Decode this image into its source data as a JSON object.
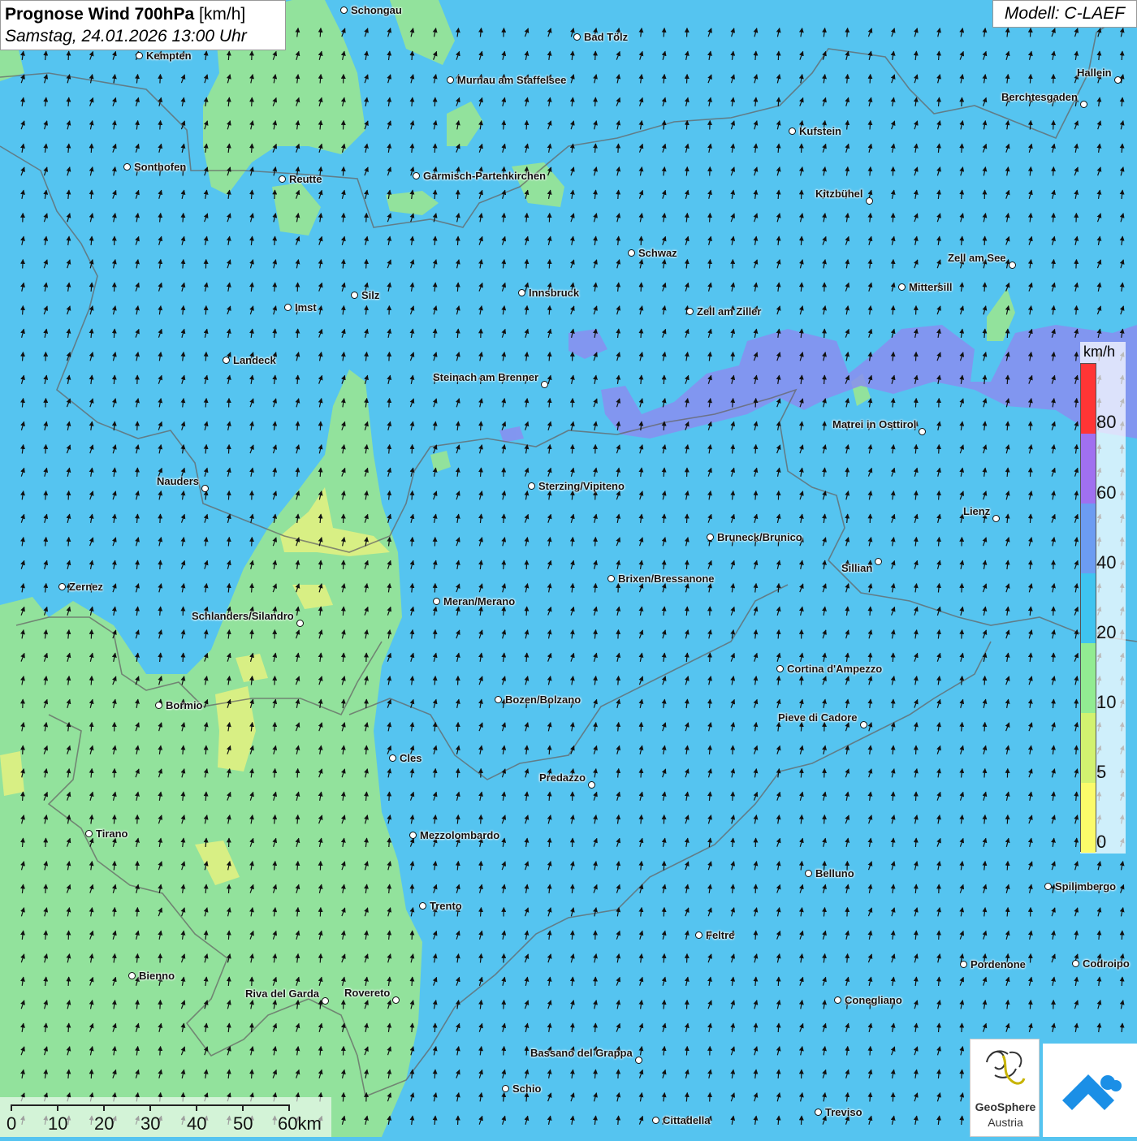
{
  "title": {
    "main": "Prognose Wind 700hPa",
    "unit": "[km/h]",
    "datetime": "Samstag, 24.01.2026 13:00 Uhr"
  },
  "model": "Modell: C-LAEF",
  "legend": {
    "unit": "km/h",
    "ticks": [
      "80",
      "60",
      "40",
      "20",
      "10",
      "5",
      "0"
    ],
    "colors": [
      "#ff3535",
      "#a070f0",
      "#6c9cf2",
      "#3fc4f0",
      "#92ec92",
      "#d2f270",
      "#fbfb6a"
    ]
  },
  "map_colors": {
    "background": "#55c4f0",
    "light_wind": "#92e29c",
    "calm": "#d8ef84",
    "strong": "#8a8ef0"
  },
  "cities": [
    {
      "name": "Schongau"
    },
    {
      "name": "Bad Tölz"
    },
    {
      "name": "Kempten"
    },
    {
      "name": "Murnau am Staffelsee"
    },
    {
      "name": "Hallein"
    },
    {
      "name": "Berchtesgaden"
    },
    {
      "name": "Kufstein"
    },
    {
      "name": "Sonthofen"
    },
    {
      "name": "Reutte"
    },
    {
      "name": "Garmisch-Partenkirchen"
    },
    {
      "name": "Kitzbühel"
    },
    {
      "name": "Schwaz"
    },
    {
      "name": "Zell am See"
    },
    {
      "name": "Mittersill"
    },
    {
      "name": "Innsbruck"
    },
    {
      "name": "Silz"
    },
    {
      "name": "Imst"
    },
    {
      "name": "Zell am Ziller"
    },
    {
      "name": "Landeck"
    },
    {
      "name": "Steinach am Brenner"
    },
    {
      "name": "Matrei in Osttirol"
    },
    {
      "name": "Nauders"
    },
    {
      "name": "Sterzing/Vipiteno"
    },
    {
      "name": "Lienz"
    },
    {
      "name": "Bruneck/Brunico"
    },
    {
      "name": "Sillian"
    },
    {
      "name": "Brixen/Bressanone"
    },
    {
      "name": "Zernez"
    },
    {
      "name": "Meran/Merano"
    },
    {
      "name": "Schlanders/Silandro"
    },
    {
      "name": "Cortina d'Ampezzo"
    },
    {
      "name": "Bozen/Bolzano"
    },
    {
      "name": "Bormio"
    },
    {
      "name": "Pieve di Cadore"
    },
    {
      "name": "Cles"
    },
    {
      "name": "Predazzo"
    },
    {
      "name": "Tirano"
    },
    {
      "name": "Mezzolombardo"
    },
    {
      "name": "Belluno"
    },
    {
      "name": "Spilimbergo"
    },
    {
      "name": "Trento"
    },
    {
      "name": "Feltre"
    },
    {
      "name": "Pordenone"
    },
    {
      "name": "Codroipo"
    },
    {
      "name": "Bienno"
    },
    {
      "name": "Riva del Garda"
    },
    {
      "name": "Rovereto"
    },
    {
      "name": "Conegliano"
    },
    {
      "name": "Bassano del Grappa"
    },
    {
      "name": "Schio"
    },
    {
      "name": "Treviso"
    },
    {
      "name": "Cittadella"
    }
  ],
  "scale_bar": {
    "labels": [
      "0",
      "10",
      "20",
      "30",
      "40",
      "50",
      "60km"
    ]
  },
  "logo": {
    "name": "GeoSphere",
    "sub": "Austria"
  }
}
